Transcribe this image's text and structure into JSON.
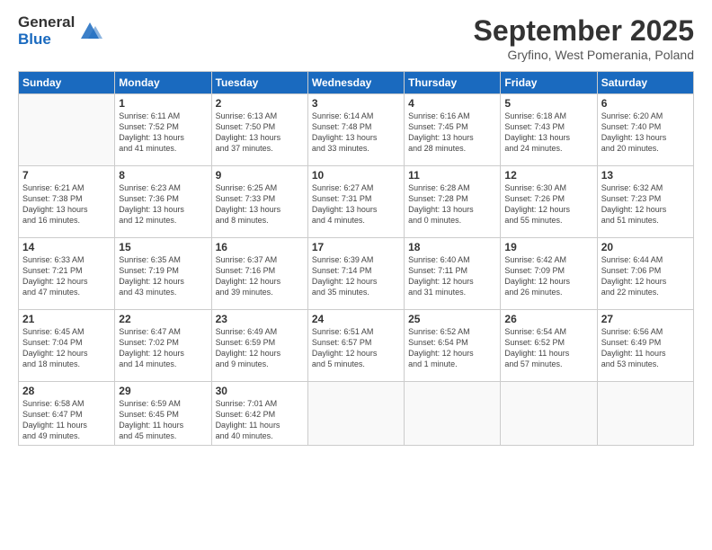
{
  "logo": {
    "general": "General",
    "blue": "Blue"
  },
  "header": {
    "month": "September 2025",
    "location": "Gryfino, West Pomerania, Poland"
  },
  "weekdays": [
    "Sunday",
    "Monday",
    "Tuesday",
    "Wednesday",
    "Thursday",
    "Friday",
    "Saturday"
  ],
  "weeks": [
    [
      {
        "day": "",
        "info": ""
      },
      {
        "day": "1",
        "info": "Sunrise: 6:11 AM\nSunset: 7:52 PM\nDaylight: 13 hours\nand 41 minutes."
      },
      {
        "day": "2",
        "info": "Sunrise: 6:13 AM\nSunset: 7:50 PM\nDaylight: 13 hours\nand 37 minutes."
      },
      {
        "day": "3",
        "info": "Sunrise: 6:14 AM\nSunset: 7:48 PM\nDaylight: 13 hours\nand 33 minutes."
      },
      {
        "day": "4",
        "info": "Sunrise: 6:16 AM\nSunset: 7:45 PM\nDaylight: 13 hours\nand 28 minutes."
      },
      {
        "day": "5",
        "info": "Sunrise: 6:18 AM\nSunset: 7:43 PM\nDaylight: 13 hours\nand 24 minutes."
      },
      {
        "day": "6",
        "info": "Sunrise: 6:20 AM\nSunset: 7:40 PM\nDaylight: 13 hours\nand 20 minutes."
      }
    ],
    [
      {
        "day": "7",
        "info": "Sunrise: 6:21 AM\nSunset: 7:38 PM\nDaylight: 13 hours\nand 16 minutes."
      },
      {
        "day": "8",
        "info": "Sunrise: 6:23 AM\nSunset: 7:36 PM\nDaylight: 13 hours\nand 12 minutes."
      },
      {
        "day": "9",
        "info": "Sunrise: 6:25 AM\nSunset: 7:33 PM\nDaylight: 13 hours\nand 8 minutes."
      },
      {
        "day": "10",
        "info": "Sunrise: 6:27 AM\nSunset: 7:31 PM\nDaylight: 13 hours\nand 4 minutes."
      },
      {
        "day": "11",
        "info": "Sunrise: 6:28 AM\nSunset: 7:28 PM\nDaylight: 13 hours\nand 0 minutes."
      },
      {
        "day": "12",
        "info": "Sunrise: 6:30 AM\nSunset: 7:26 PM\nDaylight: 12 hours\nand 55 minutes."
      },
      {
        "day": "13",
        "info": "Sunrise: 6:32 AM\nSunset: 7:23 PM\nDaylight: 12 hours\nand 51 minutes."
      }
    ],
    [
      {
        "day": "14",
        "info": "Sunrise: 6:33 AM\nSunset: 7:21 PM\nDaylight: 12 hours\nand 47 minutes."
      },
      {
        "day": "15",
        "info": "Sunrise: 6:35 AM\nSunset: 7:19 PM\nDaylight: 12 hours\nand 43 minutes."
      },
      {
        "day": "16",
        "info": "Sunrise: 6:37 AM\nSunset: 7:16 PM\nDaylight: 12 hours\nand 39 minutes."
      },
      {
        "day": "17",
        "info": "Sunrise: 6:39 AM\nSunset: 7:14 PM\nDaylight: 12 hours\nand 35 minutes."
      },
      {
        "day": "18",
        "info": "Sunrise: 6:40 AM\nSunset: 7:11 PM\nDaylight: 12 hours\nand 31 minutes."
      },
      {
        "day": "19",
        "info": "Sunrise: 6:42 AM\nSunset: 7:09 PM\nDaylight: 12 hours\nand 26 minutes."
      },
      {
        "day": "20",
        "info": "Sunrise: 6:44 AM\nSunset: 7:06 PM\nDaylight: 12 hours\nand 22 minutes."
      }
    ],
    [
      {
        "day": "21",
        "info": "Sunrise: 6:45 AM\nSunset: 7:04 PM\nDaylight: 12 hours\nand 18 minutes."
      },
      {
        "day": "22",
        "info": "Sunrise: 6:47 AM\nSunset: 7:02 PM\nDaylight: 12 hours\nand 14 minutes."
      },
      {
        "day": "23",
        "info": "Sunrise: 6:49 AM\nSunset: 6:59 PM\nDaylight: 12 hours\nand 9 minutes."
      },
      {
        "day": "24",
        "info": "Sunrise: 6:51 AM\nSunset: 6:57 PM\nDaylight: 12 hours\nand 5 minutes."
      },
      {
        "day": "25",
        "info": "Sunrise: 6:52 AM\nSunset: 6:54 PM\nDaylight: 12 hours\nand 1 minute."
      },
      {
        "day": "26",
        "info": "Sunrise: 6:54 AM\nSunset: 6:52 PM\nDaylight: 11 hours\nand 57 minutes."
      },
      {
        "day": "27",
        "info": "Sunrise: 6:56 AM\nSunset: 6:49 PM\nDaylight: 11 hours\nand 53 minutes."
      }
    ],
    [
      {
        "day": "28",
        "info": "Sunrise: 6:58 AM\nSunset: 6:47 PM\nDaylight: 11 hours\nand 49 minutes."
      },
      {
        "day": "29",
        "info": "Sunrise: 6:59 AM\nSunset: 6:45 PM\nDaylight: 11 hours\nand 45 minutes."
      },
      {
        "day": "30",
        "info": "Sunrise: 7:01 AM\nSunset: 6:42 PM\nDaylight: 11 hours\nand 40 minutes."
      },
      {
        "day": "",
        "info": ""
      },
      {
        "day": "",
        "info": ""
      },
      {
        "day": "",
        "info": ""
      },
      {
        "day": "",
        "info": ""
      }
    ]
  ]
}
